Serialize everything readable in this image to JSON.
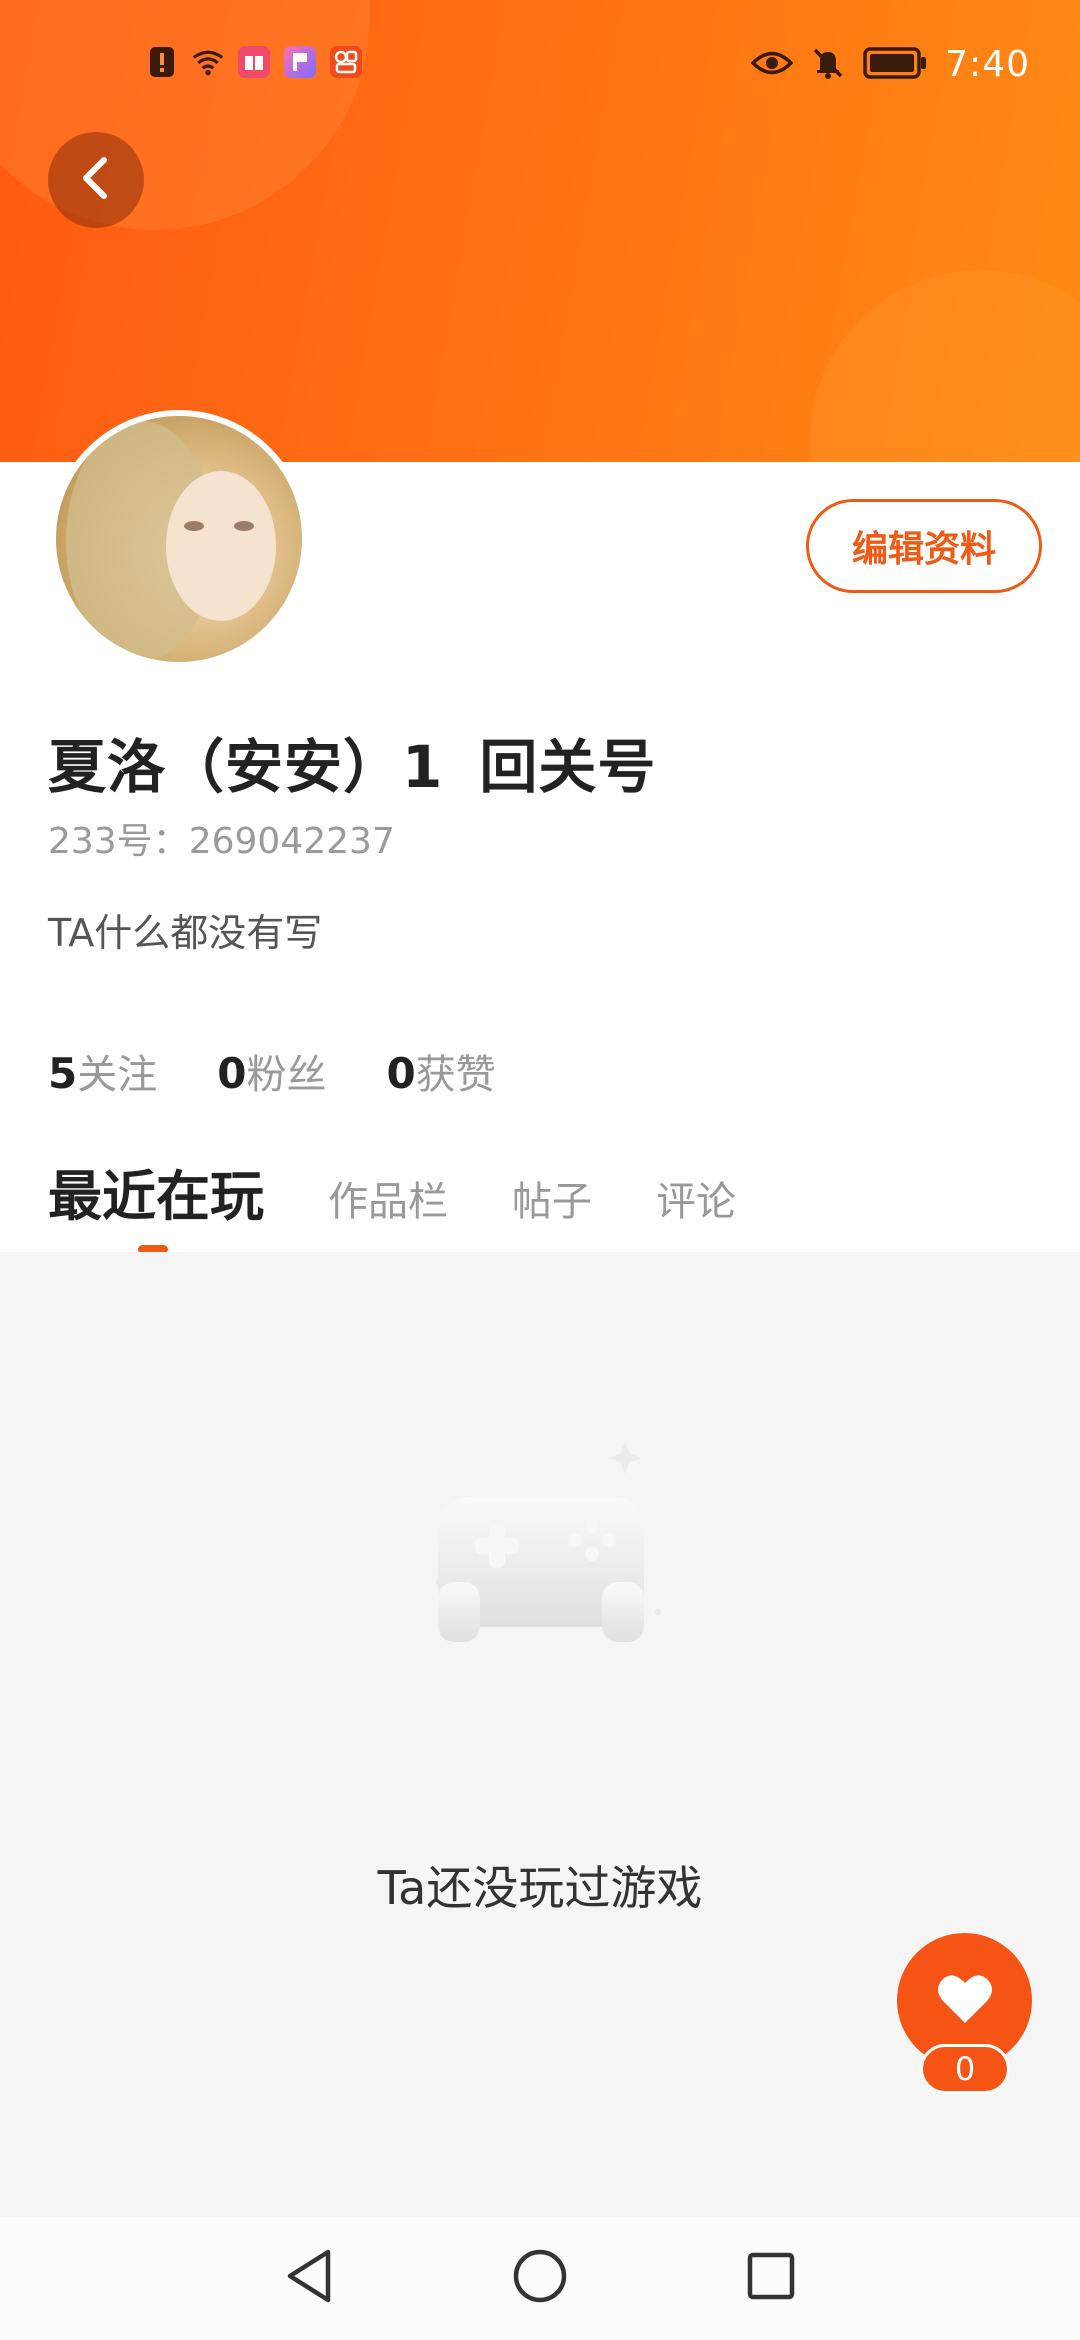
{
  "status_bar": {
    "time": "7:40",
    "left_icons": [
      "alert-icon",
      "wifi-icon",
      "book-app-icon",
      "flag-app-icon",
      "photo-app-icon"
    ],
    "right_icons": [
      "eye-icon",
      "bell-off-icon",
      "battery-icon"
    ]
  },
  "header": {
    "back_icon": "chevron-left-icon",
    "accent_color": "#ff6a14"
  },
  "profile": {
    "edit_label": "编辑资料",
    "name_main": "夏洛（安安）1",
    "name_suffix": "回关号",
    "uid": "233号：269042237",
    "bio": "TA什么都没有写",
    "stats": [
      {
        "num": "5",
        "label": "关注"
      },
      {
        "num": "0",
        "label": "粉丝"
      },
      {
        "num": "0",
        "label": "获赞"
      }
    ]
  },
  "tabs": [
    {
      "label": "最近在玩",
      "active": true
    },
    {
      "label": "作品栏",
      "active": false
    },
    {
      "label": "帖子",
      "active": false
    },
    {
      "label": "评论",
      "active": false
    }
  ],
  "empty_state": {
    "icon": "gamepad-icon",
    "text": "Ta还没玩过游戏"
  },
  "fab": {
    "icon": "heart-icon",
    "count": "0"
  },
  "nav_bar": {
    "icons": [
      "back-triangle-icon",
      "home-circle-icon",
      "recents-square-icon"
    ]
  }
}
